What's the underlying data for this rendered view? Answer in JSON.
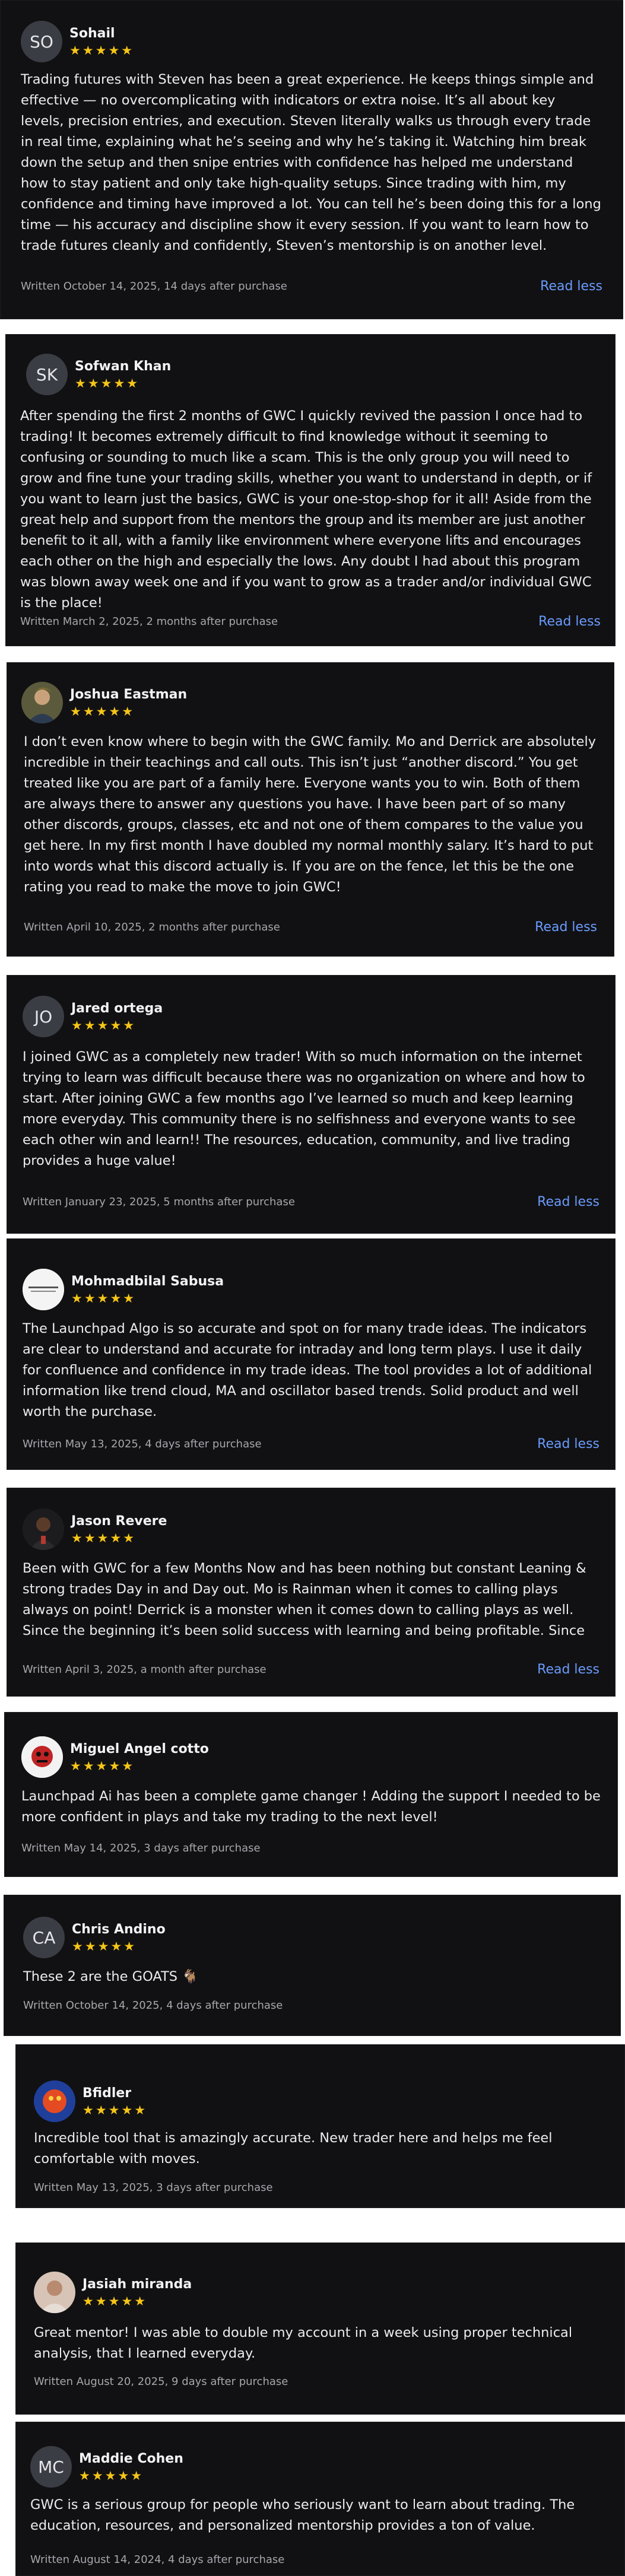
{
  "reviews": [
    {
      "name": "Sohail",
      "initials": "SO",
      "stars": "★★★★★",
      "text": "Trading futures with Steven has been a great experience. He keeps things simple and effective — no overcomplicating with indicators or extra noise. It’s all about key levels, precision entries, and execution. Steven literally walks us through every trade in real time, explaining what he’s seeing and why he’s taking it. Watching him break down the setup and then snipe entries with confidence has helped me understand how to stay patient and only take high-quality setups. Since trading with him, my confidence and timing have improved a lot. You can tell he’s been doing this for a long time — his accuracy and discipline show it every session. If you want to learn how to trade futures cleanly and confidently, Steven’s mentorship is on another level.",
      "written": "Written October 14, 2025, 14 days after purchase",
      "read_less": "Read less"
    },
    {
      "name": "Sofwan Khan",
      "initials": "SK",
      "stars": "★★★★★",
      "text": "After spending the first 2 months of GWC I quickly revived the passion I once had to trading! It becomes extremely difficult to find knowledge without it seeming to confusing or sounding to much like a scam. This is the only group you will need to grow and fine tune your trading skills, whether you want to understand in depth, or if you want to learn just the basics, GWC is your one-stop-shop for it all! Aside from the great help and support from the mentors the group and its member are just another benefit to it all, with a family like environment where everyone lifts and encourages each other on the high and especially the lows. Any doubt I had about this program was blown away week one and if you want to grow as a trader and/or individual GWC is the place!",
      "written": "Written March 2, 2025, 2 months after purchase",
      "read_less": "Read less"
    },
    {
      "name": "Joshua Eastman",
      "initials": "",
      "stars": "★★★★★",
      "text": "I don’t even know where to begin with the GWC family. Mo and Derrick are absolutely incredible in their teachings and call outs. This isn’t just “another discord.” You get treated like you are part of a family here. Everyone wants you to win. Both of them are always there to answer any questions you have. I have been part of so many other discords, groups, classes, etc and not one of them compares to the value you get here. In my first month I have doubled my normal monthly salary. It’s hard to put into words what this discord actually is. If you are on the fence, let this be the one rating you read to make the move to join GWC!",
      "written": "Written April 10, 2025, 2 months after purchase",
      "read_less": "Read less"
    },
    {
      "name": "Jared ortega",
      "initials": "JO",
      "stars": "★★★★★",
      "text": "I joined GWC as a completely new trader! With so much information on the internet trying to learn was difficult because there was no organization on where and how to start. After joining GWC a few months ago I’ve learned so much and keep learning more everyday. This community there is no selfishness and everyone wants to see each other win and learn!! The resources, education, community, and live trading provides a huge value!",
      "written": "Written January 23, 2025, 5 months after purchase",
      "read_less": "Read less"
    },
    {
      "name": "Mohmadbilal Sabusa",
      "initials": "",
      "stars": "★★★★★",
      "text": "The Launchpad Algo is so accurate and spot on for many trade ideas. The indicators are clear to understand and accurate for intraday and long term plays. I use it daily for confluence and confidence in my trade ideas. The tool provides a lot of additional information like trend cloud, MA and oscillator based trends. Solid product and well worth the purchase.",
      "written": "Written May 13, 2025, 4 days after purchase",
      "read_less": "Read less"
    },
    {
      "name": "Jason Revere",
      "initials": "",
      "stars": "★★★★★",
      "text": "Been with GWC for a few Months Now and has been nothing but constant Leaning & strong trades Day in and Day out. Mo is Rainman when it comes to calling plays always on point! Derrick is a monster when it comes down to calling plays as well. Since the beginning it’s been solid success with learning and being profitable. Since the creation of",
      "written": "Written April 3, 2025, a month after purchase",
      "read_less": "Read less"
    },
    {
      "name": "Miguel Angel cotto",
      "initials": "",
      "stars": "★★★★★",
      "text": "Launchpad Ai has been a complete game changer ! Adding the support I needed to be more confident in plays and take my trading to the next level!",
      "written": "Written May 14, 2025, 3 days after purchase",
      "read_less": ""
    },
    {
      "name": "Chris Andino",
      "initials": "CA",
      "stars": "★★★★★",
      "text": "These 2 are the GOATS 🐐",
      "written": "Written October 14, 2025, 4 days after purchase",
      "read_less": ""
    },
    {
      "name": "Bfidler",
      "initials": "",
      "stars": "★★★★★",
      "text": "Incredible tool that is amazingly accurate. New trader here and helps me feel comfortable with moves.",
      "written": "Written May 13, 2025, 3 days after purchase",
      "read_less": ""
    },
    {
      "name": "Jasiah miranda",
      "initials": "",
      "stars": "★★★★★",
      "text": "Great mentor! I was able to double my account in a week using proper technical analysis, that I learned everyday.",
      "written": "Written August 20, 2025, 9 days after purchase",
      "read_less": ""
    },
    {
      "name": "Maddie Cohen",
      "initials": "MC",
      "stars": "★★★★★",
      "text": "GWC is a serious group for people who seriously want to learn about trading. The education, resources, and personalized mentorship provides a ton of value.",
      "written": "Written August 14, 2024, 4 days after purchase",
      "read_less": ""
    }
  ]
}
